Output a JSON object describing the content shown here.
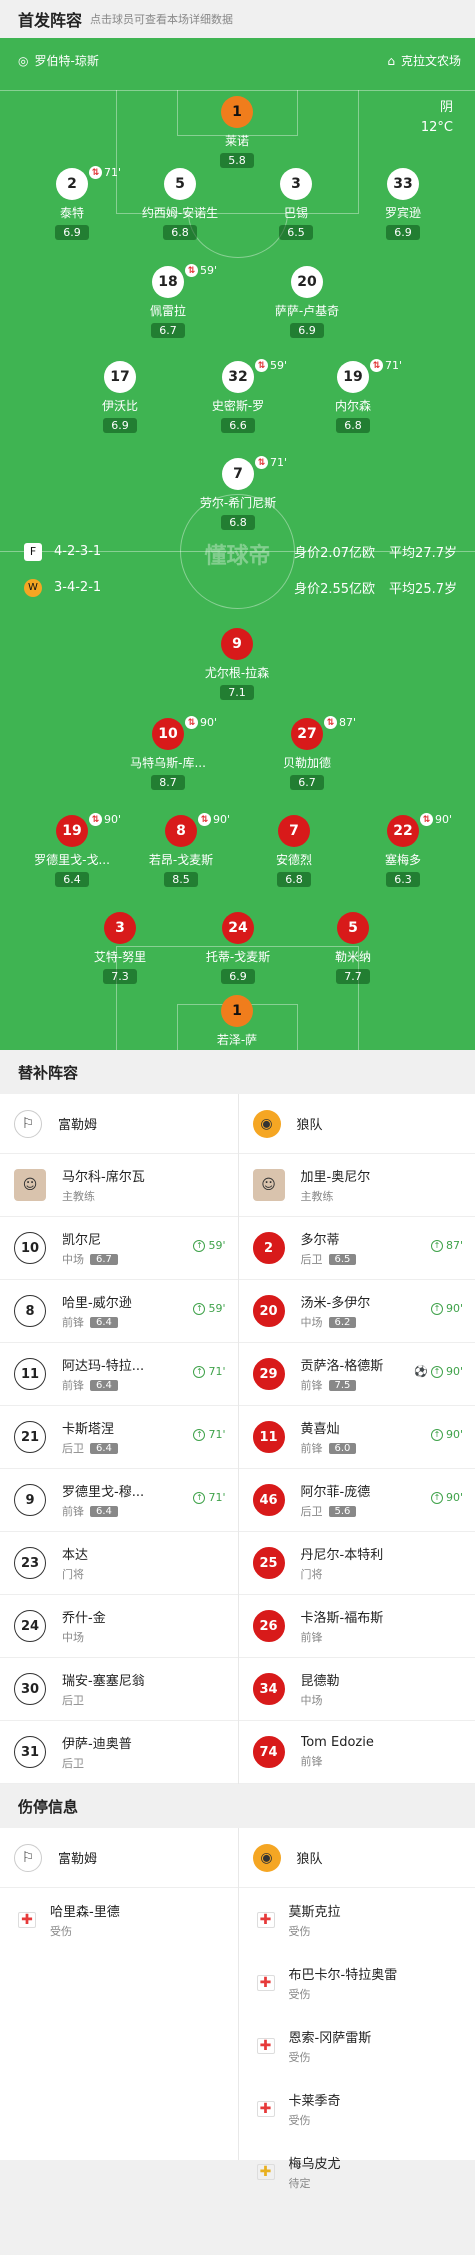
{
  "header": {
    "title": "首发阵容",
    "subtitle": "点击球员可查看本场详细数据"
  },
  "pitch": {
    "home_coach": "罗伯特-琼斯",
    "away_coach": "克拉文农场",
    "weather": "阴",
    "temperature": "12°C",
    "watermark": "懂球帝",
    "home_formation": "4-2-3-1",
    "home_value": "身价2.07亿欧",
    "home_age": "平均27.7岁",
    "away_formation": "3-4-2-1",
    "away_value": "身价2.55亿欧",
    "away_age": "平均25.7岁",
    "home_players": [
      {
        "num": "1",
        "name": "莱诺",
        "rating": "5.8"
      },
      {
        "num": "2",
        "name": "泰特",
        "rating": "6.9",
        "sub": "71'"
      },
      {
        "num": "5",
        "name": "约西姆-安诺生",
        "rating": "6.8"
      },
      {
        "num": "3",
        "name": "巴锡",
        "rating": "6.5"
      },
      {
        "num": "33",
        "name": "罗宾逊",
        "rating": "6.9"
      },
      {
        "num": "18",
        "name": "佩雷拉",
        "rating": "6.7",
        "sub": "59'"
      },
      {
        "num": "20",
        "name": "萨萨-卢基奇",
        "rating": "6.9"
      },
      {
        "num": "17",
        "name": "伊沃比",
        "rating": "6.9"
      },
      {
        "num": "32",
        "name": "史密斯-罗",
        "rating": "6.6",
        "sub": "59'"
      },
      {
        "num": "19",
        "name": "内尔森",
        "rating": "6.8",
        "sub": "71'"
      },
      {
        "num": "7",
        "name": "劳尔-希门尼斯",
        "rating": "6.8",
        "sub": "71'"
      }
    ],
    "away_players": [
      {
        "num": "9",
        "name": "尤尔根-拉森",
        "rating": "7.1"
      },
      {
        "num": "10",
        "name": "马特乌斯-库...",
        "rating": "8.7",
        "sub": "90'"
      },
      {
        "num": "27",
        "name": "贝勒加德",
        "rating": "6.7",
        "sub": "87'"
      },
      {
        "num": "19",
        "name": "罗德里戈-戈...",
        "rating": "6.4",
        "sub": "90'"
      },
      {
        "num": "8",
        "name": "若昂-戈麦斯",
        "rating": "8.5",
        "sub": "90'"
      },
      {
        "num": "7",
        "name": "安德烈",
        "rating": "6.8"
      },
      {
        "num": "22",
        "name": "塞梅多",
        "rating": "6.3",
        "sub": "90'"
      },
      {
        "num": "3",
        "name": "艾特-努里",
        "rating": "7.3"
      },
      {
        "num": "24",
        "name": "托蒂-戈麦斯",
        "rating": "6.9"
      },
      {
        "num": "5",
        "name": "勒米纳",
        "rating": "7.7"
      },
      {
        "num": "1",
        "name": "若泽-萨",
        "rating": "6.7"
      }
    ]
  },
  "subs": {
    "title": "替补阵容",
    "home_team": "富勒姆",
    "away_team": "狼队",
    "home_coach": {
      "name": "马尔科-席尔瓦",
      "role": "主教练"
    },
    "away_coach": {
      "name": "加里-奥尼尔",
      "role": "主教练"
    },
    "home": [
      {
        "num": "10",
        "name": "凯尔尼",
        "pos": "中场",
        "rating": "6.7",
        "time": "59'"
      },
      {
        "num": "8",
        "name": "哈里-威尔逊",
        "pos": "前锋",
        "rating": "6.4",
        "time": "59'"
      },
      {
        "num": "11",
        "name": "阿达玛-特拉...",
        "pos": "前锋",
        "rating": "6.4",
        "time": "71'"
      },
      {
        "num": "21",
        "name": "卡斯塔涅",
        "pos": "后卫",
        "rating": "6.4",
        "time": "71'"
      },
      {
        "num": "9",
        "name": "罗德里戈-穆...",
        "pos": "前锋",
        "rating": "6.4",
        "time": "71'"
      },
      {
        "num": "23",
        "name": "本达",
        "pos": "门将"
      },
      {
        "num": "24",
        "name": "乔什-金",
        "pos": "中场"
      },
      {
        "num": "30",
        "name": "瑞安-塞塞尼翁",
        "pos": "后卫"
      },
      {
        "num": "31",
        "name": "伊萨-迪奥普",
        "pos": "后卫"
      }
    ],
    "away": [
      {
        "num": "2",
        "name": "多尔蒂",
        "pos": "后卫",
        "rating": "6.5",
        "time": "87'"
      },
      {
        "num": "20",
        "name": "汤米-多伊尔",
        "pos": "中场",
        "rating": "6.2",
        "time": "90'"
      },
      {
        "num": "29",
        "name": "贡萨洛-格德斯",
        "pos": "前锋",
        "rating": "7.5",
        "time": "90'",
        "goal": true
      },
      {
        "num": "11",
        "name": "黄喜灿",
        "pos": "前锋",
        "rating": "6.0",
        "time": "90'"
      },
      {
        "num": "46",
        "name": "阿尔菲-庞德",
        "pos": "后卫",
        "rating": "5.6",
        "time": "90'"
      },
      {
        "num": "25",
        "name": "丹尼尔-本特利",
        "pos": "门将"
      },
      {
        "num": "26",
        "name": "卡洛斯-福布斯",
        "pos": "前锋"
      },
      {
        "num": "34",
        "name": "昆德勒",
        "pos": "中场"
      },
      {
        "num": "74",
        "name": "Tom Edozie",
        "pos": "前锋"
      }
    ]
  },
  "injuries": {
    "title": "伤停信息",
    "home_team": "富勒姆",
    "away_team": "狼队",
    "home": [
      {
        "name": "哈里森-里德",
        "status": "受伤",
        "kind": "injury"
      }
    ],
    "away": [
      {
        "name": "莫斯克拉",
        "status": "受伤",
        "kind": "injury"
      },
      {
        "name": "布巴卡尔-特拉奥雷",
        "status": "受伤",
        "kind": "injury"
      },
      {
        "name": "恩索-冈萨雷斯",
        "status": "受伤",
        "kind": "injury"
      },
      {
        "name": "卡莱季奇",
        "status": "受伤",
        "kind": "injury"
      },
      {
        "name": "梅乌皮尤",
        "status": "待定",
        "kind": "doubt"
      }
    ]
  },
  "colors": {
    "pitch": "#3fb452",
    "away_red": "#d81a1a",
    "keeper": "#f07d1c",
    "card": "#f5d312"
  }
}
